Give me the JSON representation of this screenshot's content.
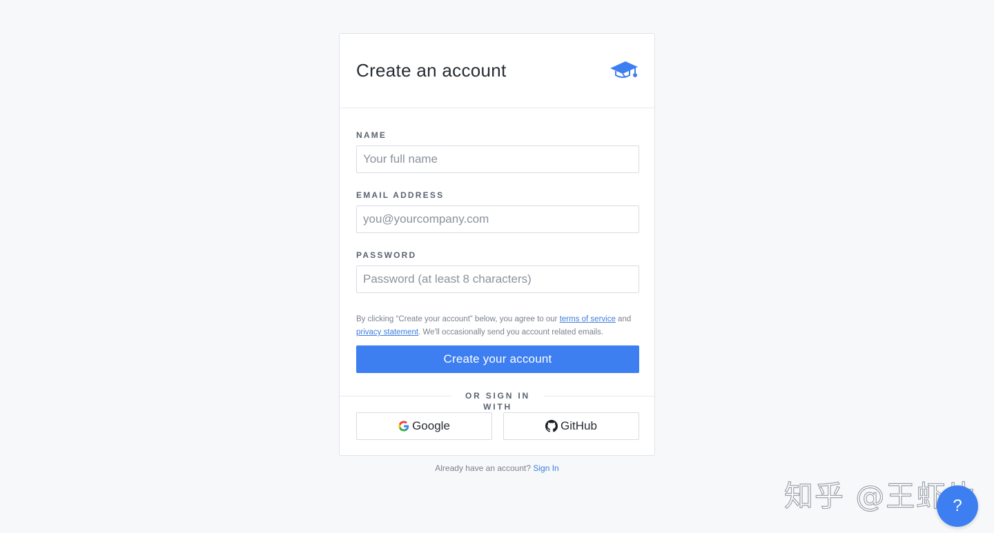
{
  "card": {
    "title": "Create an account"
  },
  "form": {
    "name": {
      "label": "NAME",
      "placeholder": "Your full name"
    },
    "email": {
      "label": "EMAIL ADDRESS",
      "placeholder": "you@yourcompany.com"
    },
    "password": {
      "label": "PASSWORD",
      "placeholder": "Password (at least 8 characters)"
    }
  },
  "legal": {
    "prefix": "By clicking “Create your account” below, you agree to our ",
    "terms_link": "terms of service",
    "middle": " and ",
    "privacy_link": "privacy statement",
    "suffix": ". We'll occasionally send you account related emails."
  },
  "submit_label": "Create your account",
  "divider": "OR SIGN IN WITH",
  "social": {
    "google": "Google",
    "github": "GitHub"
  },
  "footer": {
    "prompt": "Already have an account? ",
    "signin_link": "Sign In"
  },
  "watermark": "知乎 @王虾片",
  "help_label": "?",
  "colors": {
    "accent": "#3d7ef0",
    "link": "#3b7ddd",
    "background": "#f7f8fa"
  },
  "icons": {
    "logo": "graduation-cap-logo-icon",
    "google": "google-g-icon",
    "github": "github-octocat-icon"
  }
}
